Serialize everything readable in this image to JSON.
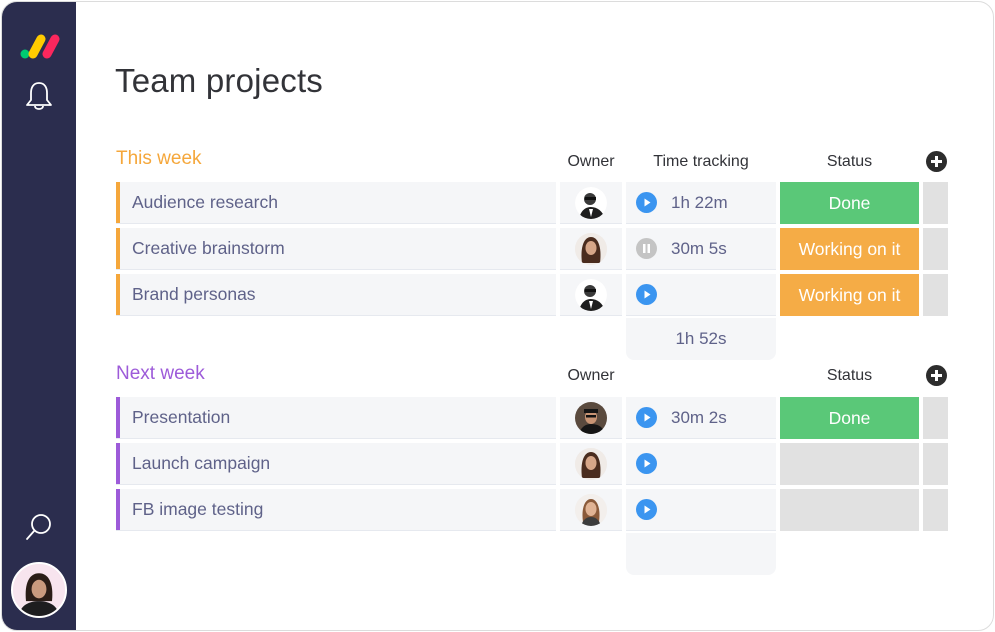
{
  "sidebar": {
    "logo": "monday-logo",
    "icons": [
      "bell-icon",
      "search-icon"
    ],
    "user_avatar": "user-avatar"
  },
  "page": {
    "title": "Team projects"
  },
  "colors": {
    "sidebar_bg": "#2b2d4e",
    "this_week": "#f5a73b",
    "next_week": "#9d5bd9",
    "done": "#5ac878",
    "working": "#f5ac46",
    "empty_status": "#e1e1e1",
    "play": "#3b95f0",
    "paused": "#c4c4c4"
  },
  "groups": [
    {
      "title": "This week",
      "columns": {
        "owner": "Owner",
        "time": "Time tracking",
        "status": "Status"
      },
      "rows": [
        {
          "name": "Audience research",
          "owner": "man-sunglasses",
          "timer": "play",
          "time": "1h 22m",
          "status": "Done"
        },
        {
          "name": "Creative brainstorm",
          "owner": "woman-long-hair",
          "timer": "pause",
          "time": "30m 5s",
          "status": "Working on it"
        },
        {
          "name": "Brand personas",
          "owner": "man-sunglasses",
          "timer": "play",
          "time": "",
          "status": "Working on it"
        }
      ],
      "time_total": "1h 52s"
    },
    {
      "title": "Next week",
      "columns": {
        "owner": "Owner",
        "time": "",
        "status": "Status"
      },
      "rows": [
        {
          "name": "Presentation",
          "owner": "man-cap",
          "timer": "play",
          "time": "30m 2s",
          "status": "Done"
        },
        {
          "name": "Launch campaign",
          "owner": "woman-long-hair",
          "timer": "play",
          "time": "",
          "status": ""
        },
        {
          "name": "FB image testing",
          "owner": "woman-blonde",
          "timer": "play",
          "time": "",
          "status": ""
        }
      ],
      "time_total": ""
    }
  ]
}
